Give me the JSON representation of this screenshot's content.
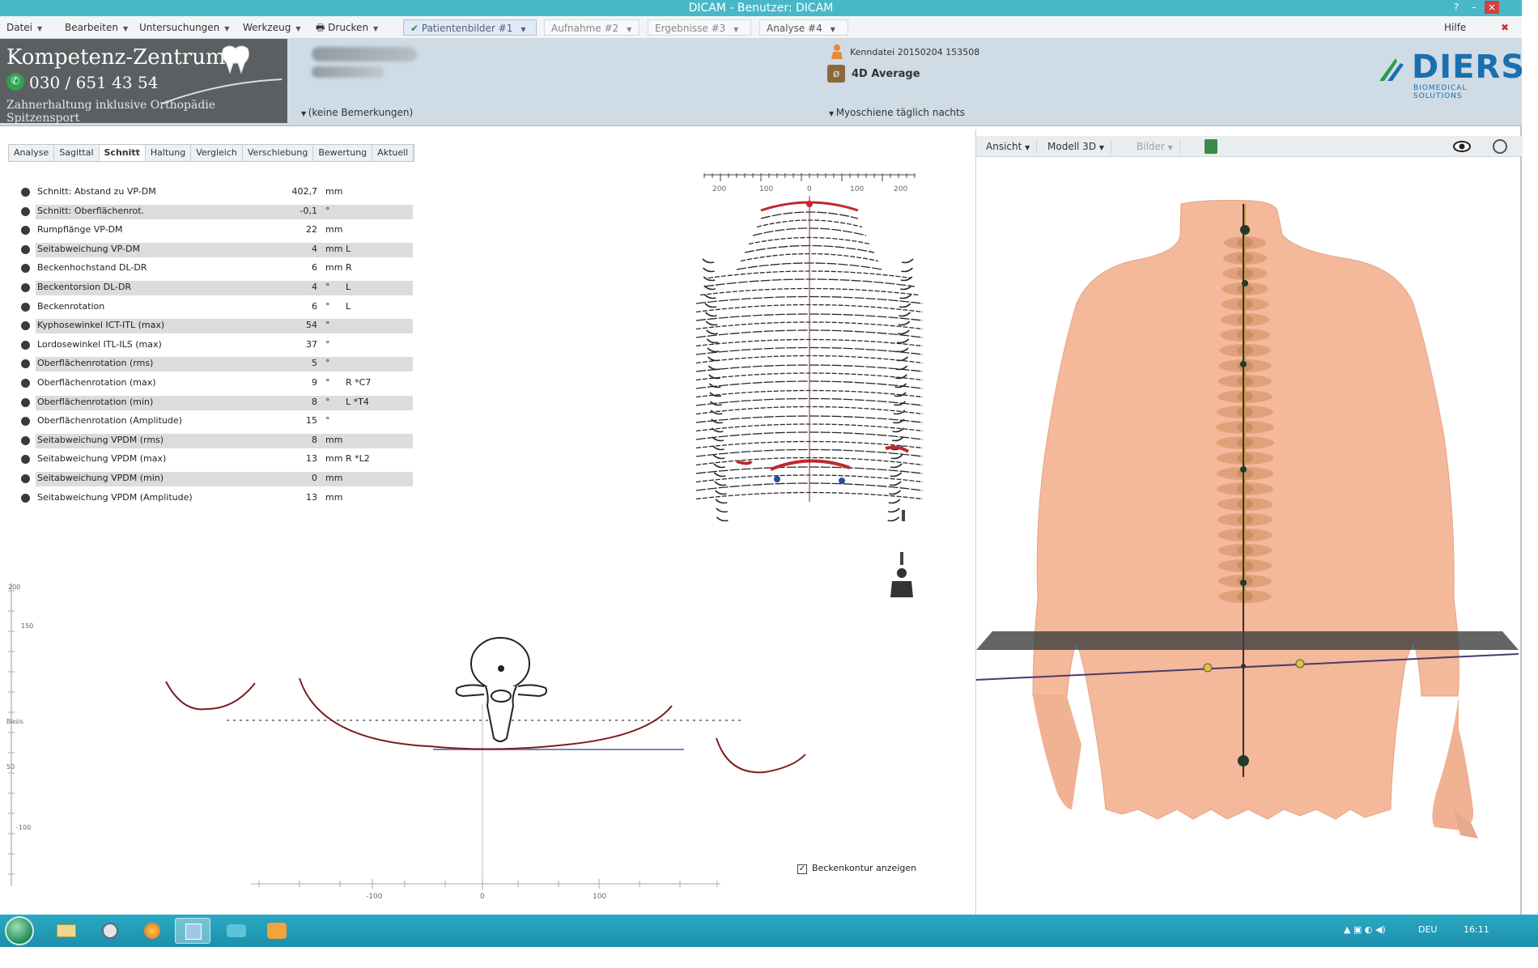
{
  "window": {
    "title": "DICAM - Benutzer: DICAM",
    "controls": [
      "?",
      "–",
      "×"
    ]
  },
  "menubar": {
    "items": [
      {
        "label": "Datei"
      },
      {
        "label": "Bearbeiten"
      },
      {
        "label": "Untersuchungen"
      },
      {
        "label": "Werkzeug"
      },
      {
        "label": "Drucken"
      }
    ],
    "tabs": [
      {
        "label": "Patientenbilder #1",
        "active": true
      },
      {
        "label": "Aufnahme #2",
        "active": false
      },
      {
        "label": "Ergebnisse #3",
        "active": false
      },
      {
        "label": "Analyse #4",
        "active": false
      }
    ],
    "help": "Hilfe"
  },
  "header": {
    "logo": {
      "line1": "Kompetenz-Zentrum",
      "phone": "030 / 651 43 54",
      "line3": "Zahnerhaltung inklusive Orthopädie Spitzensport"
    },
    "remarks": "(keine Bemerkungen)",
    "record_date": "Kenndatei 20150204 153508",
    "mode": "4D Average",
    "posture_note": "Myoschiene täglich nachts",
    "brand": "DIERS",
    "brand_sub": "BIOMEDICAL SOLUTIONS"
  },
  "subtabs": [
    "Analyse",
    "Sagittal",
    "Schnitt",
    "Haltung",
    "Vergleich",
    "Verschiebung",
    "Bewertung",
    "Aktuell"
  ],
  "active_subtab": "Schnitt",
  "params": [
    {
      "label": "Schnitt: Abstand zu VP-DM",
      "value": "402,7",
      "unit": "mm",
      "extra": ""
    },
    {
      "label": "Schnitt: Oberflächenrot.",
      "value": "-0,1",
      "unit": "°",
      "extra": ""
    },
    {
      "label": "Rumpflänge VP-DM",
      "value": "22",
      "unit": "mm",
      "extra": ""
    },
    {
      "label": "Seitabweichung VP-DM",
      "value": "4",
      "unit": "mm",
      "extra": "L"
    },
    {
      "label": "Beckenhochstand DL-DR",
      "value": "6",
      "unit": "mm",
      "extra": "R"
    },
    {
      "label": "Beckentorsion DL-DR",
      "value": "4",
      "unit": "°",
      "extra": "L"
    },
    {
      "label": "Beckenrotation",
      "value": "6",
      "unit": "°",
      "extra": "L"
    },
    {
      "label": "Kyphosewinkel ICT-ITL (max)",
      "value": "54",
      "unit": "°",
      "extra": ""
    },
    {
      "label": "Lordosewinkel ITL-ILS (max)",
      "value": "37",
      "unit": "°",
      "extra": ""
    },
    {
      "label": "Oberflächenrotation (rms)",
      "value": "5",
      "unit": "°",
      "extra": ""
    },
    {
      "label": "Oberflächenrotation (max)",
      "value": "9",
      "unit": "°",
      "extra": "R  *C7"
    },
    {
      "label": "Oberflächenrotation (min)",
      "value": "8",
      "unit": "°",
      "extra": "L  *T4"
    },
    {
      "label": "Oberflächenrotation (Amplitude)",
      "value": "15",
      "unit": "°",
      "extra": ""
    },
    {
      "label": "Seitabweichung VPDM (rms)",
      "value": "8",
      "unit": "mm",
      "extra": ""
    },
    {
      "label": "Seitabweichung VPDM (max)",
      "value": "13",
      "unit": "mm",
      "extra": "R  *L2"
    },
    {
      "label": "Seitabweichung VPDM (min)",
      "value": "0",
      "unit": "mm",
      "extra": ""
    },
    {
      "label": "Seitabweichung VPDM (Amplitude)",
      "value": "13",
      "unit": "mm",
      "extra": ""
    }
  ],
  "section": {
    "y_axis_ticks": [
      "200",
      "150",
      "Basis",
      "50",
      "-100"
    ],
    "x_axis_ticks": [
      "-100",
      "0",
      "100"
    ],
    "checkbox_label": "Beckenkontur anzeigen"
  },
  "contour_scale": [
    "200",
    "100",
    "0",
    "100",
    "200"
  ],
  "right_toolbar": {
    "view": "Ansicht",
    "model": "Modell 3D",
    "images": "Bilder"
  },
  "taskbar": {
    "lang": "DEU",
    "time": "16:11"
  },
  "colors": {
    "titlebar": "#48b8c8",
    "header": "#cfdce6",
    "skin": "#f4b89a",
    "accent_red": "#c0282d",
    "taskbar": "#1c8fab",
    "brand": "#1b6fae"
  }
}
